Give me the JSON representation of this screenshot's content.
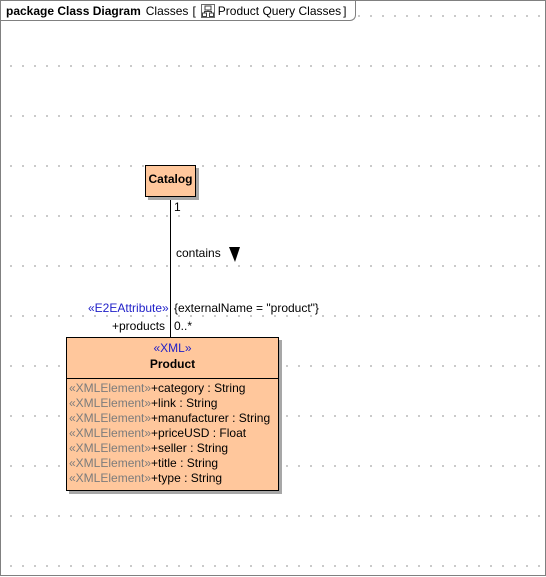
{
  "frame": {
    "keyword": "package",
    "title": "Class Diagram",
    "package_name": "Classes",
    "bracket_open": "[",
    "diagram_icon": "class-diagram-icon",
    "diagram_name": "Product Query Classes",
    "bracket_close": "]"
  },
  "classes": {
    "catalog": {
      "name": "Catalog"
    },
    "product": {
      "stereotype": "«XML»",
      "name": "Product",
      "attributes": [
        {
          "stereotype": "«XMLElement»",
          "text": "+category",
          "type": " : String"
        },
        {
          "stereotype": "«XMLElement»",
          "text": "+link",
          "type": " : String"
        },
        {
          "stereotype": "«XMLElement»",
          "text": "+manufacturer",
          "type": " : String"
        },
        {
          "stereotype": "«XMLElement»",
          "text": "+priceUSD",
          "type": " : Float"
        },
        {
          "stereotype": "«XMLElement»",
          "text": "+seller",
          "type": " : String"
        },
        {
          "stereotype": "«XMLElement»",
          "text": "+title",
          "type": " : String"
        },
        {
          "stereotype": "«XMLElement»",
          "text": "+type",
          "type": " : String"
        }
      ]
    }
  },
  "association": {
    "name": "contains",
    "direction_icon": "direction-arrow-down-icon",
    "source_multiplicity": "1",
    "target_multiplicity": "0..*",
    "target_role": "+products",
    "target_stereotype": "«E2EAttribute»",
    "tagged_value": "{externalName = \"product\"}"
  },
  "colors": {
    "class_fill": "#ffc79c",
    "stereotype_blue": "#1f1fc8",
    "attribute_stereotype_gray": "#7c7c7c"
  }
}
